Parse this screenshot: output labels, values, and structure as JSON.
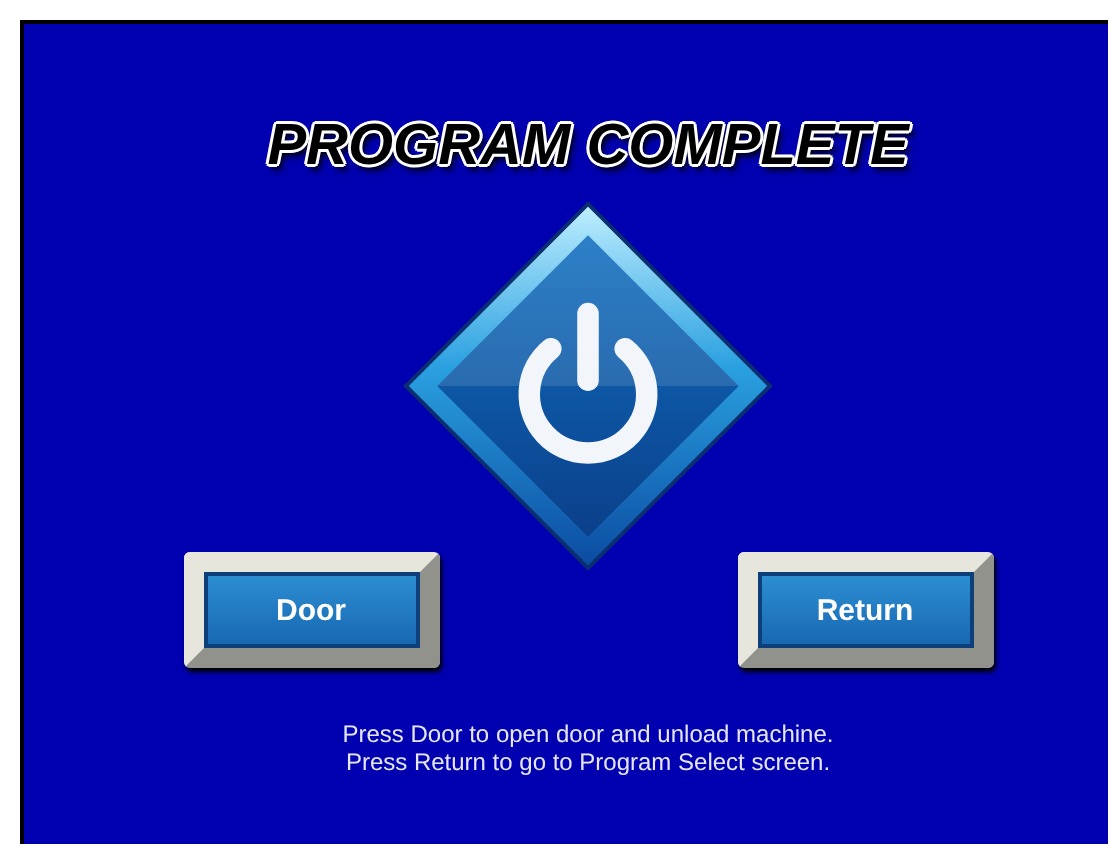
{
  "title": "PROGRAM COMPLETE",
  "buttons": [
    {
      "label": "Door"
    },
    {
      "label": "Return"
    }
  ],
  "instructions": [
    "Press Door to open door and unload machine.",
    "Press Return to go to Program Select screen."
  ]
}
